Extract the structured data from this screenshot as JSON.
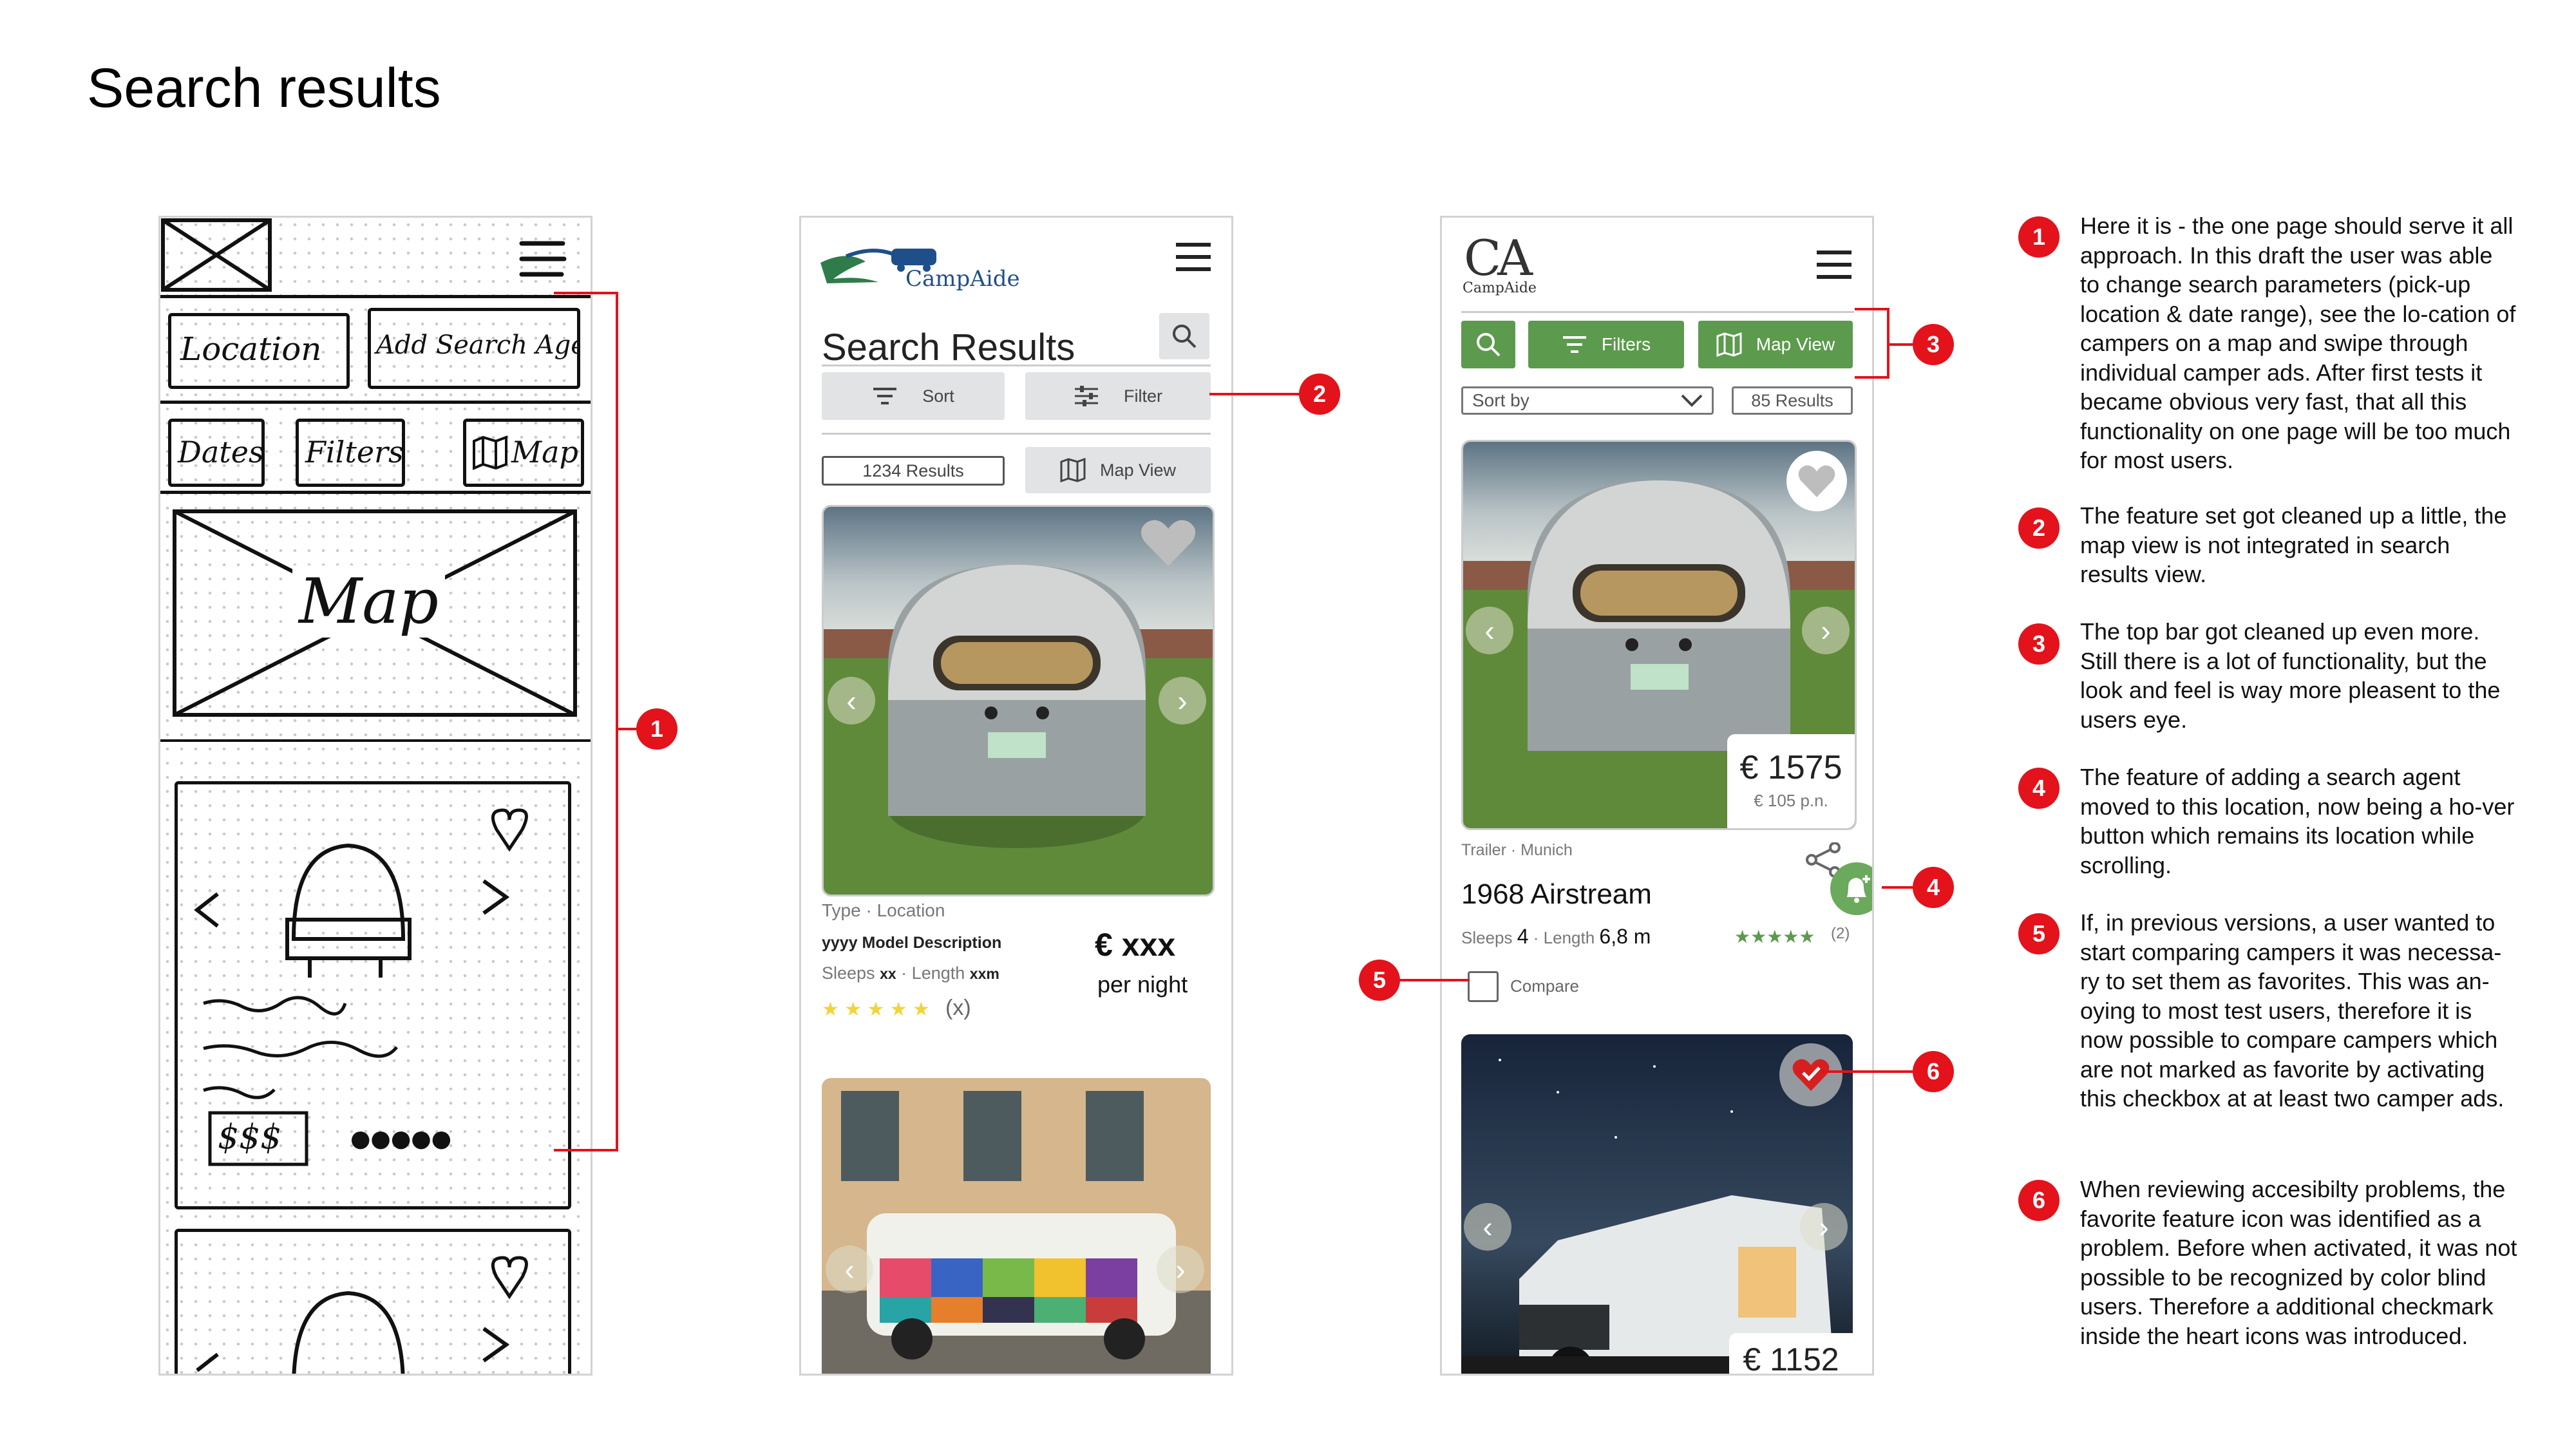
{
  "page": {
    "title": "Search results"
  },
  "sketch": {
    "location": "Location",
    "add_search_agent": "Add Search Agent",
    "dates": "Dates",
    "filters": "Filters",
    "map_btn": "Map",
    "map": "Map",
    "price": "$$$",
    "rating": "●●●●●"
  },
  "mid": {
    "logo_text": "CampAide",
    "title": "Search Results",
    "sort": "Sort",
    "filter": "Filter",
    "results": "1234 Results",
    "map_view": "Map View",
    "card": {
      "type": "Type · Location",
      "model": "yyyy Model Description",
      "sleeps": "Sleeps",
      "sleeps_val": "xx",
      "length": "Length",
      "length_val": "xxm",
      "price": "€ xxx",
      "per_night": "per night",
      "stars": "★ ★ ★ ★ ★",
      "reviews": "(x)"
    }
  },
  "right": {
    "logo_mark": "CA",
    "logo_text": "CampAide",
    "filters": "Filters",
    "map_view": "Map View",
    "sort_by": "Sort by",
    "results": "85 Results",
    "card1": {
      "price": "€ 1575",
      "per_person": "€ 105 p.n.",
      "type": "Trailer · Munich",
      "title": "1968 Airstream",
      "sleeps": "Sleeps",
      "sleeps_val": "4",
      "length": "Length",
      "length_val": "6,8 m",
      "stars": "★★★★★",
      "reviews": "(2)",
      "compare": "Compare"
    },
    "card2": {
      "price": "€ 1152"
    }
  },
  "annotations": [
    {
      "num": "1",
      "text": "Here it is - the one page should serve it all approach. In this draft the user was able to change search parameters (pick-up location & date range), see the lo-cation of campers on a map and swipe through individual camper ads. After first tests it became obvious very fast, that all this functionality on one page will be too much for most users."
    },
    {
      "num": "2",
      "text": "The feature set got cleaned up a little, the map view is not integrated in search results view."
    },
    {
      "num": "3",
      "text": "The top bar got cleaned up even more. Still there is a lot of functionality, but the look and feel is way more pleasent to the users eye."
    },
    {
      "num": "4",
      "text": "The feature of adding a search agent moved to this location, now being a ho-ver button which remains its location while scrolling."
    },
    {
      "num": "5",
      "text": "If, in previous versions, a user wanted to start comparing campers it was necessa-ry to set them as favorites. This was an-oying to most test users, therefore it is now possible to compare campers which are not marked as favorite by activating this checkbox at at least two camper ads."
    },
    {
      "num": "6",
      "text": "When reviewing accesibilty problems, the favorite feature icon was identified as a problem. Before when activated, it was not possible to be recognized by color blind users. Therefore a additional checkmark inside the heart icons was introduced."
    }
  ],
  "colors": {
    "accent_green": "#5c9a4d",
    "annotation_red": "#e3121b",
    "star_yellow": "#f2d43a",
    "star_green": "#5c9a4d"
  }
}
